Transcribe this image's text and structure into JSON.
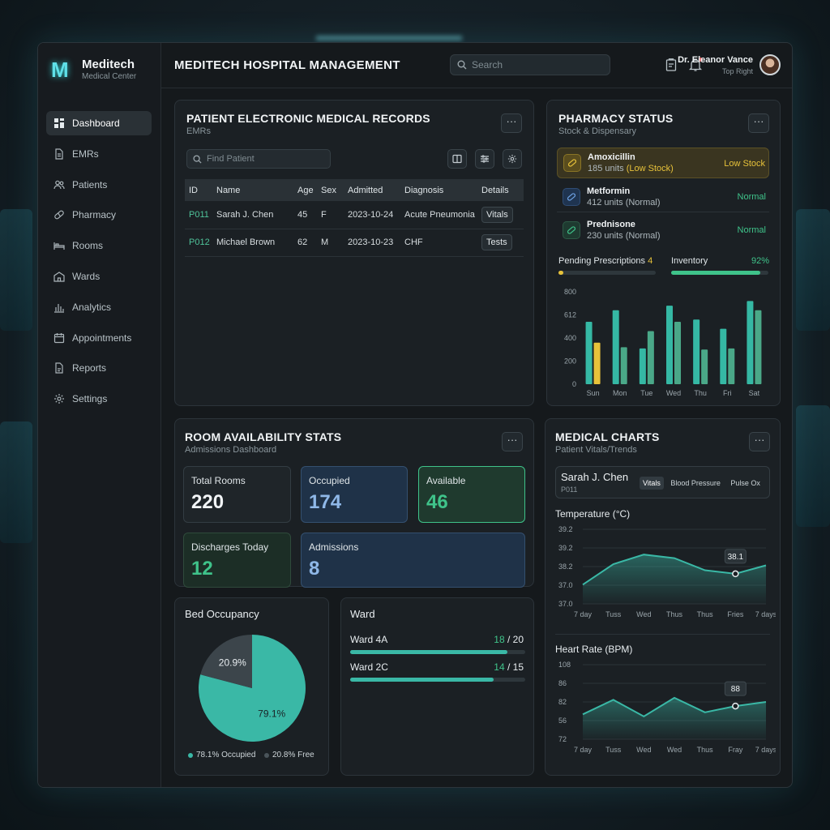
{
  "brand": {
    "logo": "M",
    "name": "Meditech",
    "subtitle": "Medical Center"
  },
  "sidebar": {
    "items": [
      {
        "label": "Dashboard",
        "icon": "grid-icon",
        "active": true
      },
      {
        "label": "EMRs",
        "icon": "document-icon"
      },
      {
        "label": "Patients",
        "icon": "users-icon"
      },
      {
        "label": "Pharmacy",
        "icon": "pill-icon"
      },
      {
        "label": "Rooms",
        "icon": "bed-icon"
      },
      {
        "label": "Wards",
        "icon": "building-icon"
      },
      {
        "label": "Analytics",
        "icon": "bar-chart-icon"
      },
      {
        "label": "Appointments",
        "icon": "calendar-icon"
      },
      {
        "label": "Reports",
        "icon": "report-icon"
      },
      {
        "label": "Settings",
        "icon": "gear-icon"
      }
    ]
  },
  "header": {
    "title": "MEDITECH HOSPITAL MANAGEMENT",
    "search_placeholder": "Search",
    "user_name": "Dr. Eleanor Vance",
    "user_role": "Top Right"
  },
  "emr": {
    "title": "PATIENT ELECTRONIC MEDICAL RECORDS",
    "subtitle": "EMRs",
    "more": "···",
    "find_placeholder": "Find Patient",
    "columns": [
      "ID",
      "Name",
      "Age",
      "Sex",
      "Admitted",
      "Diagnosis",
      "Details"
    ],
    "rows": [
      {
        "id": "P011",
        "name": "Sarah J. Chen",
        "age": "45",
        "sex": "F",
        "admitted": "2023-10-24",
        "diagnosis": "Acute Pneumonia",
        "details": "Vitals"
      },
      {
        "id": "P012",
        "name": "Michael Brown",
        "age": "62",
        "sex": "M",
        "admitted": "2023-10-23",
        "diagnosis": "CHF",
        "details": "Tests"
      }
    ]
  },
  "pharmacy": {
    "title": "PHARMACY STATUS",
    "subtitle": "Stock & Dispensary",
    "more": "···",
    "meds": [
      {
        "name": "Amoxicillin",
        "units": "185 units",
        "units_status": "(Low Stock)",
        "status": "Low Stock",
        "color": "#e7c23a"
      },
      {
        "name": "Metformin",
        "units": "412 units (Normal)",
        "units_status": "",
        "status": "Normal",
        "color": "#3fc38a"
      },
      {
        "name": "Prednisone",
        "units": "230 units (Normal)",
        "units_status": "",
        "status": "Normal",
        "color": "#3fc38a"
      }
    ],
    "pending_label": "Pending Prescriptions",
    "pending_value": "4",
    "pending_fraction": 0.05,
    "inventory_label": "Inventory",
    "inventory_value": "92%",
    "inventory_fraction": 0.92
  },
  "pharmacy_chart": {
    "chart_data": {
      "type": "bar",
      "categories": [
        "Sun",
        "Mon",
        "Tue",
        "Wed",
        "Thu",
        "Fri",
        "Sat"
      ],
      "y_ticks": [
        "0",
        "200",
        "400",
        "612",
        "800"
      ],
      "ylim": [
        0,
        800
      ],
      "series": [
        {
          "values": [
            540,
            640,
            310,
            680,
            560,
            480,
            720
          ],
          "color": "#35b8a4"
        },
        {
          "values": [
            360,
            320,
            460,
            540,
            300,
            310,
            640
          ],
          "color": "#4aa888"
        }
      ],
      "highlight": {
        "index": 0,
        "series": 1,
        "color": "#e7c23a"
      }
    }
  },
  "rooms": {
    "title": "ROOM AVAILABILITY STATS",
    "subtitle": "Admissions Dashboard",
    "more": "···",
    "total_label": "Total Rooms",
    "total_value": "220",
    "occupied_label": "Occupied",
    "occupied_value": "174",
    "available_label": "Available",
    "available_value": "46",
    "discharges_label": "Discharges Today",
    "discharges_value": "12",
    "admissions_label": "Admissions",
    "admissions_value": "8"
  },
  "bed": {
    "title": "Bed Occupancy",
    "chart_data": {
      "type": "pie",
      "slices": [
        {
          "label": "Occupied",
          "value": 79.1,
          "text": "79.1%",
          "color": "#3ab8a6"
        },
        {
          "label": "Free",
          "value": 20.9,
          "text": "20.9%",
          "color": "#3c454b"
        }
      ]
    },
    "legend_occupied": "78.1% Occupied",
    "legend_free": "20.8% Free"
  },
  "ward": {
    "title": "Ward",
    "items": [
      {
        "name": "Ward 4A",
        "used": "18",
        "total": "/ 20",
        "fraction": 0.9
      },
      {
        "name": "Ward 2C",
        "used": "14",
        "total": "/ 15",
        "fraction": 0.82
      }
    ]
  },
  "medical": {
    "title": "MEDICAL CHARTS",
    "subtitle": "Patient Vitals/Trends",
    "more": "···",
    "patient_name": "Sarah J. Chen",
    "patient_id": "P011",
    "tabs": [
      "Vitals",
      "Blood Pressure",
      "Pulse Ox"
    ],
    "temp": {
      "title": "Temperature (°C)",
      "chart_data": {
        "type": "area",
        "y_ticks": [
          "37.0",
          "37.0",
          "38.2",
          "39.2",
          "39.2"
        ],
        "x_labels": [
          "7 day",
          "Tuss",
          "Wed",
          "Thus",
          "Thus",
          "Fries",
          "7 days"
        ],
        "values": [
          37.6,
          38.45,
          38.85,
          38.7,
          38.2,
          38.05,
          38.4
        ],
        "ylim": [
          36.8,
          39.9
        ],
        "callout": "38.1",
        "callout_index": 5
      }
    },
    "hr": {
      "title": "Heart Rate (BPM)",
      "chart_data": {
        "type": "area",
        "y_ticks": [
          "72",
          "56",
          "82",
          "86",
          "108"
        ],
        "x_labels": [
          "7 day",
          "Tuss",
          "Wed",
          "Wed",
          "Thus",
          "Fray",
          "7 days"
        ],
        "values": [
          60,
          67,
          59,
          68,
          61,
          64,
          66
        ],
        "ylim": [
          48,
          84
        ],
        "callout": "88",
        "callout_index": 5
      }
    }
  },
  "colors": {
    "accent": "#3ab8a6",
    "green": "#3fc38a",
    "yellow": "#e7c23a",
    "blue_card": "#1f3248"
  }
}
